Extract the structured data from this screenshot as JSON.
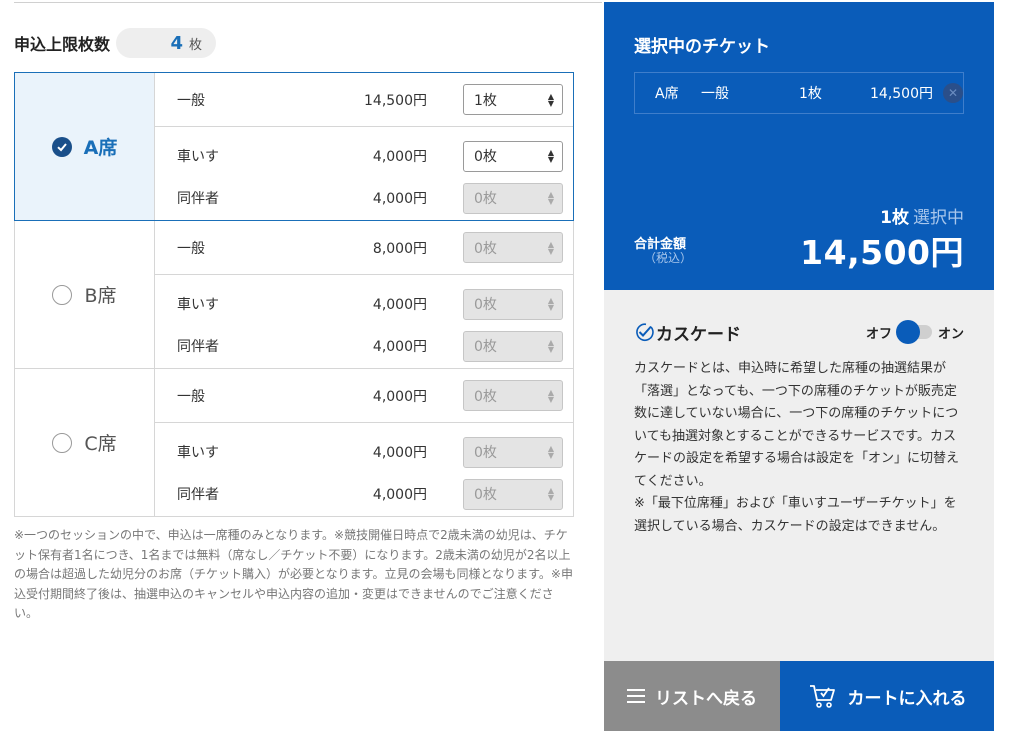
{
  "limit": {
    "label": "申込上限枚数",
    "value": "4",
    "unit": "枚"
  },
  "seats": [
    {
      "name": "A席",
      "selected": true,
      "rows": [
        {
          "type": "一般",
          "price": "14,500円",
          "qty": "1枚",
          "enabled": true
        },
        {
          "type": "車いす",
          "price": "4,000円",
          "qty": "0枚",
          "enabled": true
        },
        {
          "type": "同伴者",
          "price": "4,000円",
          "qty": "0枚",
          "enabled": false
        }
      ]
    },
    {
      "name": "B席",
      "selected": false,
      "rows": [
        {
          "type": "一般",
          "price": "8,000円",
          "qty": "0枚",
          "enabled": false
        },
        {
          "type": "車いす",
          "price": "4,000円",
          "qty": "0枚",
          "enabled": false
        },
        {
          "type": "同伴者",
          "price": "4,000円",
          "qty": "0枚",
          "enabled": false
        }
      ]
    },
    {
      "name": "C席",
      "selected": false,
      "rows": [
        {
          "type": "一般",
          "price": "4,000円",
          "qty": "0枚",
          "enabled": false
        },
        {
          "type": "車いす",
          "price": "4,000円",
          "qty": "0枚",
          "enabled": false
        },
        {
          "type": "同伴者",
          "price": "4,000円",
          "qty": "0枚",
          "enabled": false
        }
      ]
    }
  ],
  "note": "※一つのセッションの中で、申込は一席種のみとなります。※競技開催日時点で2歳未満の幼児は、チケット保有者1名につき、1名までは無料（席なし／チケット不要）になります。2歳未満の幼児が2名以上の場合は超過した幼児分のお席（チケット購入）が必要となります。立見の会場も同様となります。※申込受付期間終了後は、抽選申込のキャンセルや申込内容の追加・変更はできませんのでご注意ください。",
  "selected_panel": {
    "title": "選択中のチケット",
    "ticket": {
      "seat": "A席",
      "type": "一般",
      "qty": "1枚",
      "price": "14,500円",
      "remove_icon": "close-icon"
    },
    "count_value": "1枚",
    "count_label": "選択中",
    "total_label": "合計金額",
    "total_sub": "（税込）",
    "total_value": "14,500円"
  },
  "cascade": {
    "icon": "check-circle-icon",
    "title": "カスケード",
    "toggle_off": "オフ",
    "toggle_on": "オン",
    "toggle_state": "off",
    "description": [
      "カスケードとは、申込時に希望した席種の抽選結果が「落選」となっても、一つ下の席種のチケットが販売定数に達していない場合に、一つ下の席種のチケットについても抽選対象とすることができるサービスです。カスケードの設定を希望する場合は設定を「オン」に切替えてください。",
      "※「最下位席種」および「車いすユーザーチケット」を選択している場合、カスケードの設定はできません。"
    ]
  },
  "buttons": {
    "back_label": "リストへ戻る",
    "back_icon": "menu-icon",
    "cart_label": "カートに入れる",
    "cart_icon": "cart-icon"
  },
  "colors": {
    "primary": "#0a5cb9",
    "selected_bg": "#eaf3fb",
    "panel_bg": "#efefef",
    "back_btn": "#8c8c8c"
  }
}
